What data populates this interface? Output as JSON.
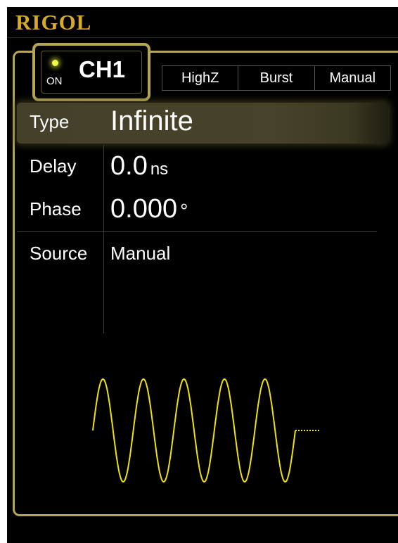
{
  "brand": "RIGOL",
  "channel": {
    "state": "ON",
    "name": "CH1",
    "indicator_color": "#f0ff40"
  },
  "status_bar": [
    "HighZ",
    "Burst",
    "Manual"
  ],
  "params": {
    "type": {
      "label": "Type",
      "value": "Infinite"
    },
    "delay": {
      "label": "Delay",
      "value": "0.0",
      "unit": "ns"
    },
    "phase": {
      "label": "Phase",
      "value": "0.000",
      "unit": "°"
    },
    "source": {
      "label": "Source",
      "value": "Manual"
    }
  },
  "waveform": {
    "kind": "sine-burst",
    "cycles": 5,
    "color": "#f0e010"
  },
  "colors": {
    "brand": "#d6a928",
    "frame": "#b5a655",
    "background": "#000000"
  }
}
